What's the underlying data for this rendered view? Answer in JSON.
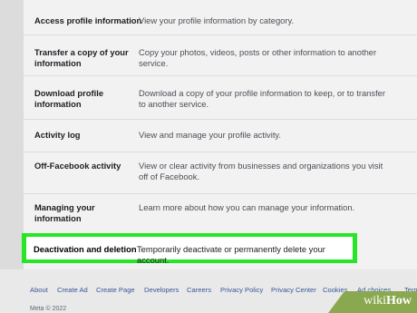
{
  "settings": {
    "rows": [
      {
        "label": "Access profile information",
        "description": "View your profile information by category."
      },
      {
        "label": "Transfer a copy of your information",
        "description": "Copy your photos, videos, posts or other information to another service."
      },
      {
        "label": "Download profile information",
        "description": "Download a copy of your profile information to keep, or to transfer to another service."
      },
      {
        "label": "Activity log",
        "description": "View and manage your profile activity."
      },
      {
        "label": "Off-Facebook activity",
        "description": "View or clear activity from businesses and organizations you visit off of Facebook."
      },
      {
        "label": "Managing your information",
        "description": "Learn more about how you can manage your information."
      }
    ],
    "highlighted": {
      "label": "Deactivation and deletion",
      "description": "Temporarily deactivate or permanently delete your account.",
      "highlight_color": "#27e627"
    }
  },
  "footer": {
    "links": [
      "About",
      "Create Ad",
      "Create Page",
      "Developers",
      "Careers",
      "Privacy Policy",
      "Privacy Center",
      "Cookies",
      "Ad choices",
      "Terms"
    ],
    "copyright": "Meta © 2022"
  },
  "watermark": {
    "wiki": "wiki",
    "how": "How"
  }
}
